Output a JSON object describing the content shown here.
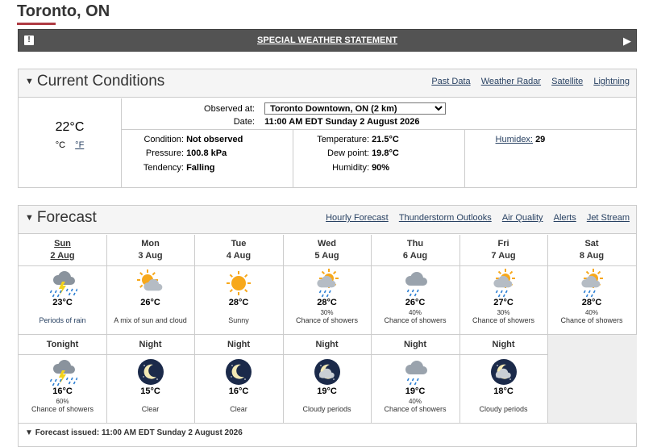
{
  "header": {
    "city": "Toronto, ON"
  },
  "alert": {
    "icon": "!",
    "title": "SPECIAL WEATHER STATEMENT",
    "arrow": "▶"
  },
  "current": {
    "title": "Current Conditions",
    "links": [
      "Past Data",
      "Weather Radar",
      "Satellite",
      "Lightning"
    ],
    "temp": "22°C",
    "unit_c": "°C",
    "unit_f": "°F",
    "observed_label": "Observed at:",
    "observed_value": "Toronto Downtown, ON (2 km)",
    "date_label": "Date:",
    "date_value": "11:00 AM EDT Sunday 2 August 2026",
    "condition_label": "Condition:",
    "condition_value": "Not observed",
    "pressure_label": "Pressure:",
    "pressure_value": "100.8 kPa",
    "tendency_label": "Tendency:",
    "tendency_value": "Falling",
    "temperature_label": "Temperature:",
    "temperature_value": "21.5°C",
    "dewpoint_label": "Dew point:",
    "dewpoint_value": "19.8°C",
    "humidity_label": "Humidity:",
    "humidity_value": "90%",
    "humidex_label": "Humidex:",
    "humidex_value": "29"
  },
  "forecast": {
    "title": "Forecast",
    "links": [
      "Hourly Forecast",
      "Thunderstorm Outlooks",
      "Air Quality",
      "Alerts",
      "Jet Stream"
    ],
    "days": [
      {
        "day": "Sun",
        "date": "2 Aug",
        "icon": "rain-thunder-icon",
        "temp": "23°C",
        "pop": "",
        "summary": "Periods of rain"
      },
      {
        "day": "Mon",
        "date": "3 Aug",
        "icon": "sun-cloud-icon",
        "temp": "26°C",
        "pop": "",
        "summary": "A mix of sun and cloud"
      },
      {
        "day": "Tue",
        "date": "4 Aug",
        "icon": "sun-icon",
        "temp": "28°C",
        "pop": "",
        "summary": "Sunny"
      },
      {
        "day": "Wed",
        "date": "5 Aug",
        "icon": "sun-shower-icon",
        "temp": "28°C",
        "pop": "30%",
        "summary": "Chance of showers"
      },
      {
        "day": "Thu",
        "date": "6 Aug",
        "icon": "cloud-shower-icon",
        "temp": "26°C",
        "pop": "40%",
        "summary": "Chance of showers"
      },
      {
        "day": "Fri",
        "date": "7 Aug",
        "icon": "sun-shower-icon",
        "temp": "27°C",
        "pop": "30%",
        "summary": "Chance of showers"
      },
      {
        "day": "Sat",
        "date": "8 Aug",
        "icon": "sun-shower-icon",
        "temp": "28°C",
        "pop": "40%",
        "summary": "Chance of showers"
      }
    ],
    "nights": [
      {
        "label": "Tonight",
        "icon": "rain-thunder-icon",
        "temp": "16°C",
        "pop": "60%",
        "summary": "Chance of showers"
      },
      {
        "label": "Night",
        "icon": "moon-icon",
        "temp": "15°C",
        "pop": "",
        "summary": "Clear"
      },
      {
        "label": "Night",
        "icon": "moon-icon",
        "temp": "16°C",
        "pop": "",
        "summary": "Clear"
      },
      {
        "label": "Night",
        "icon": "moon-cloud-icon",
        "temp": "19°C",
        "pop": "",
        "summary": "Cloudy periods"
      },
      {
        "label": "Night",
        "icon": "cloud-shower-icon",
        "temp": "19°C",
        "pop": "40%",
        "summary": "Chance of showers"
      },
      {
        "label": "Night",
        "icon": "moon-cloud-icon",
        "temp": "18°C",
        "pop": "",
        "summary": "Cloudy periods"
      }
    ],
    "issued": "Forecast issued: 11:00 AM EDT Sunday 2 August 2026",
    "issued_arrow": "▼"
  },
  "colors": {
    "accent": "#af3c43",
    "link": "#284162",
    "alert_bg": "#535353",
    "sun": "#f7a81b",
    "cloud": "#9aa3ad",
    "rain": "#2d7fd3",
    "night": "#1b2a4a"
  }
}
